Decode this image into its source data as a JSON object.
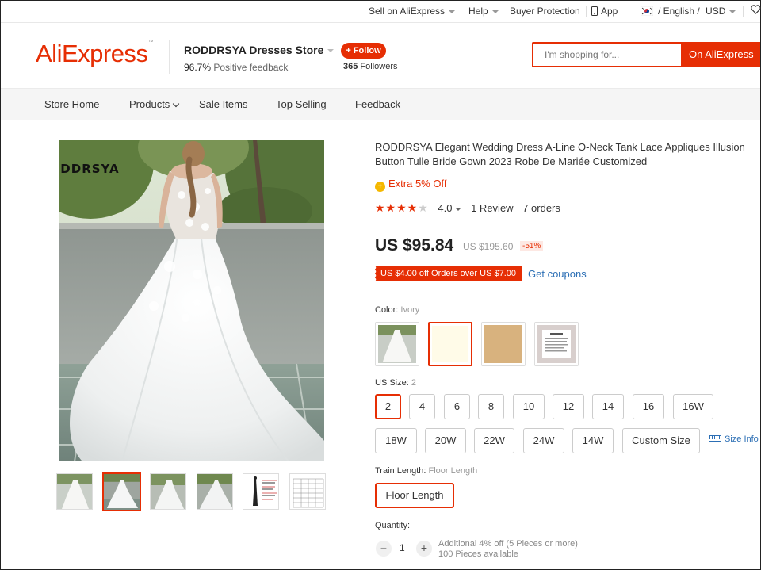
{
  "topbar": {
    "sell": "Sell on AliExpress",
    "help": "Help",
    "protection": "Buyer Protection",
    "app": "App",
    "lang": "/ English /",
    "currency": "USD"
  },
  "header": {
    "logo": "AliExpress",
    "store_name": "RODDRSYA Dresses Store",
    "feedback_pct": "96.7%",
    "feedback_label": "Positive feedback",
    "follow_label": "+ Follow",
    "followers_count": "365",
    "followers_label": "Followers",
    "search_placeholder": "I'm shopping for...",
    "search_button": "On AliExpress"
  },
  "store_nav": {
    "items": [
      "Store Home",
      "Products",
      "Sale Items",
      "Top Selling",
      "Feedback"
    ]
  },
  "gallery": {
    "watermark": "RODDRSYA",
    "selected_thumb": 1
  },
  "product": {
    "title": "RODDRSYA Elegant Wedding Dress A-Line O-Neck Tank Lace Appliques Illusion Button Tulle Bride Gown 2023 Robe De Mariée Customized",
    "extra_off": "Extra 5% Off",
    "rating_value": "4.0",
    "reviews": "1 Review",
    "orders": "7 orders",
    "price": "US $95.84",
    "original_price": "US $195.60",
    "discount": "-51%",
    "coupon": "US $4.00 off Orders over US $7.00",
    "get_coupons": "Get coupons",
    "color_label": "Color:",
    "color_value": "Ivory",
    "size_label": "US Size:",
    "size_value": "2",
    "sizes_row1": [
      "2",
      "4",
      "6",
      "8",
      "10",
      "12",
      "14",
      "16",
      "16W"
    ],
    "sizes_row2": [
      "18W",
      "20W",
      "22W",
      "24W",
      "14W",
      "Custom Size"
    ],
    "size_info": "Size Info",
    "train_label": "Train Length:",
    "train_value": "Floor Length",
    "train_option": "Floor Length",
    "quantity_label": "Quantity:",
    "quantity": "1",
    "qty_note_1": "Additional 4% off (5 Pieces or more)",
    "qty_note_2": "100 Pieces available"
  },
  "colors": {
    "accent": "#e62e04",
    "link": "#2c6fb5",
    "ivory": "#fffbe8",
    "champagne": "#d8b27e"
  }
}
